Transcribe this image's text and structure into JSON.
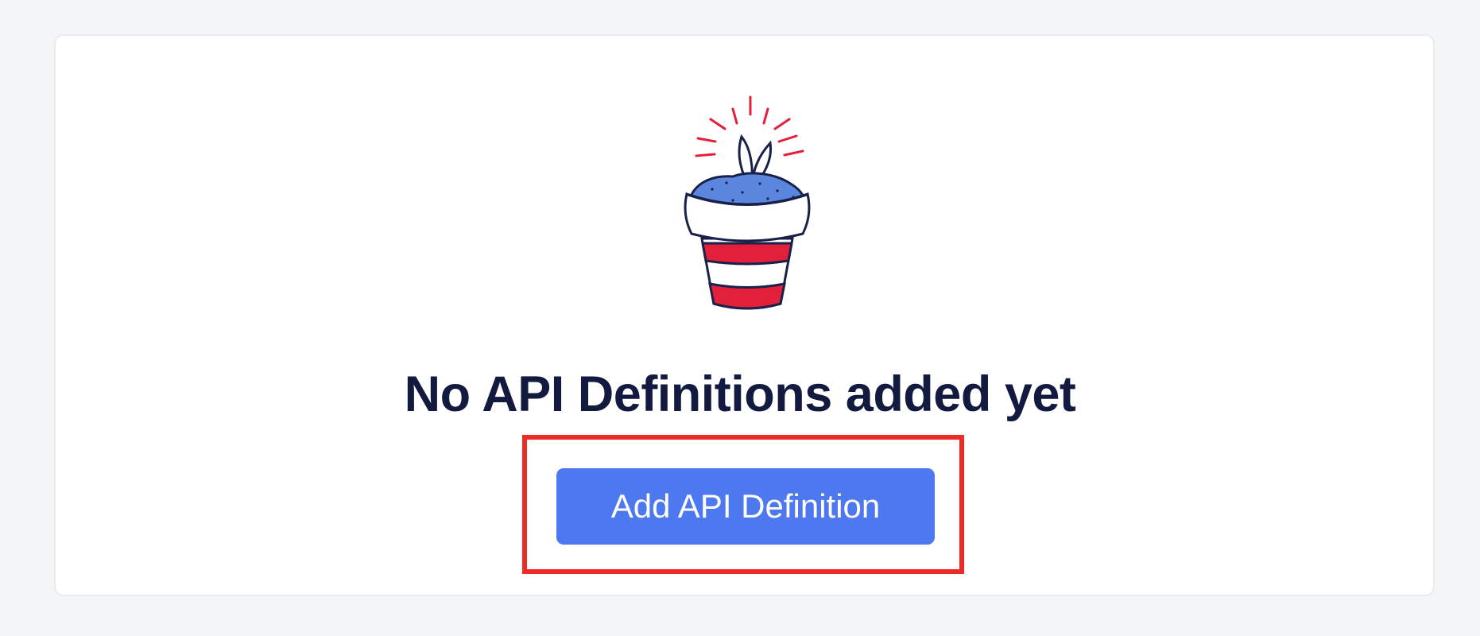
{
  "empty_state": {
    "illustration_icon": "plant-pot-icon",
    "title": "No API Definitions added yet",
    "add_button_label": "Add API Definition"
  },
  "colors": {
    "page_background": "#f4f5f7",
    "card_background": "#ffffff",
    "title_text": "#131a40",
    "button_background": "#4d78f0",
    "button_text": "#ffffff",
    "highlight_outline": "#ee2b24",
    "pot_red": "#e3203b",
    "soil_blue": "#5a86de",
    "outline_navy": "#19214a"
  }
}
